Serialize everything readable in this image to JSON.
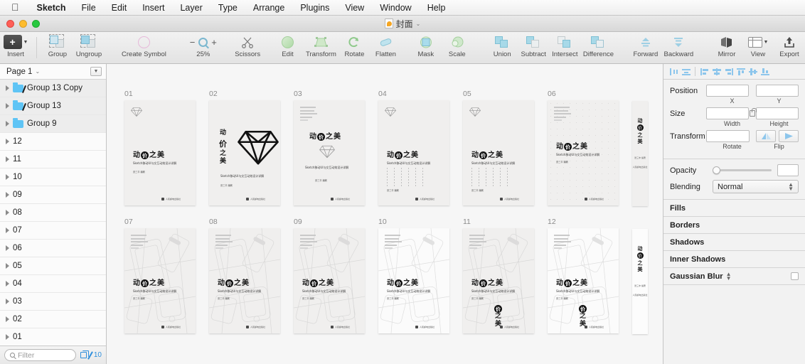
{
  "menubar": {
    "apple": "",
    "items": [
      {
        "label": "Sketch",
        "bold": true
      },
      {
        "label": "File"
      },
      {
        "label": "Edit"
      },
      {
        "label": "Insert"
      },
      {
        "label": "Layer"
      },
      {
        "label": "Type"
      },
      {
        "label": "Arrange"
      },
      {
        "label": "Plugins"
      },
      {
        "label": "View"
      },
      {
        "label": "Window"
      },
      {
        "label": "Help"
      }
    ]
  },
  "titlebar": {
    "document_title": "封面",
    "caret": "⌄"
  },
  "toolbar": {
    "insert": "Insert",
    "group": "Group",
    "ungroup": "Ungroup",
    "create_symbol": "Create Symbol",
    "zoom_minus": "−",
    "zoom_plus": "+",
    "zoom_level": "25%",
    "scissors": "Scissors",
    "edit": "Edit",
    "transform": "Transform",
    "rotate": "Rotate",
    "flatten": "Flatten",
    "mask": "Mask",
    "scale": "Scale",
    "union": "Union",
    "subtract": "Subtract",
    "intersect": "Intersect",
    "difference": "Difference",
    "forward": "Forward",
    "backward": "Backward",
    "mirror": "Mirror",
    "view": "View",
    "export": "Export"
  },
  "sidebar": {
    "page_name": "Page 1",
    "page_caret": "⌄",
    "layers": [
      {
        "name": "Group 13 Copy",
        "type": "folder-pen",
        "group": true
      },
      {
        "name": "Group 13",
        "type": "folder-pen",
        "group": true
      },
      {
        "name": "Group 9",
        "type": "folder",
        "group": true
      },
      {
        "name": "12",
        "type": "artboard",
        "group": false
      },
      {
        "name": "11",
        "type": "artboard",
        "group": false
      },
      {
        "name": "10",
        "type": "artboard",
        "group": false
      },
      {
        "name": "09",
        "type": "artboard",
        "group": false
      },
      {
        "name": "08",
        "type": "artboard",
        "group": false
      },
      {
        "name": "07",
        "type": "artboard",
        "group": false
      },
      {
        "name": "06",
        "type": "artboard",
        "group": false
      },
      {
        "name": "05",
        "type": "artboard",
        "group": false
      },
      {
        "name": "04",
        "type": "artboard",
        "group": false
      },
      {
        "name": "03",
        "type": "artboard",
        "group": false
      },
      {
        "name": "02",
        "type": "artboard",
        "group": false
      },
      {
        "name": "01",
        "type": "artboard",
        "group": false
      }
    ],
    "filter_placeholder": "Filter",
    "layer_count": "10"
  },
  "canvas": {
    "cover": {
      "title_chars": [
        "动",
        "之",
        "美"
      ],
      "title_circle": "价",
      "subtitle": "Sketch移动UI与交互动效设计详解",
      "author": "张三丰 编著",
      "publisher": "人民邮电出版社",
      "spine_chars": [
        "动",
        "之",
        "美"
      ],
      "spine_circle": "价"
    },
    "artboards": [
      {
        "label": "01",
        "variant": "plain-diamond"
      },
      {
        "label": "02",
        "variant": "big-diamond"
      },
      {
        "label": "03",
        "variant": "toplines-diamond"
      },
      {
        "label": "04",
        "variant": "diamond-vlines"
      },
      {
        "label": "05",
        "variant": "diamond-vlines"
      },
      {
        "label": "06",
        "variant": "grid"
      },
      {
        "label": "07",
        "variant": "wireframe"
      },
      {
        "label": "08",
        "variant": "wireframe"
      },
      {
        "label": "09",
        "variant": "wireframe"
      },
      {
        "label": "10",
        "variant": "wireframe-white"
      },
      {
        "label": "11",
        "variant": "wireframe-badge"
      },
      {
        "label": "12",
        "variant": "wireframe-badge-white"
      }
    ]
  },
  "inspector": {
    "align_icons": [
      "align-left-icon",
      "align-center-horizontal-icon",
      "distribute-left-icon",
      "distribute-center-icon",
      "distribute-right-icon",
      "align-top-icon",
      "align-middle-icon",
      "align-bottom-icon"
    ],
    "position_label": "Position",
    "position_x_label": "X",
    "position_y_label": "Y",
    "position_x_value": "",
    "position_y_value": "",
    "size_label": "Size",
    "width_label": "Width",
    "height_label": "Height",
    "width_value": "",
    "height_value": "",
    "transform_label": "Transform",
    "rotate_label": "Rotate",
    "rotate_value": "",
    "flip_label": "Flip",
    "opacity_label": "Opacity",
    "opacity_value": "",
    "blending_label": "Blending",
    "blending_value": "Normal",
    "sections": [
      {
        "label": "Fills",
        "checkbox": false
      },
      {
        "label": "Borders",
        "checkbox": false
      },
      {
        "label": "Shadows",
        "checkbox": false
      },
      {
        "label": "Inner Shadows",
        "checkbox": false
      },
      {
        "label": "Gaussian Blur",
        "checkbox": true,
        "stepper": true
      }
    ]
  },
  "colors": {
    "accent_blue": "#2f8fdc",
    "folder_blue": "#5fc4f5",
    "align_blue": "#8dc6ec",
    "traffic_red": "#ff5f57",
    "traffic_yellow": "#febc2e",
    "traffic_green": "#28c840"
  }
}
